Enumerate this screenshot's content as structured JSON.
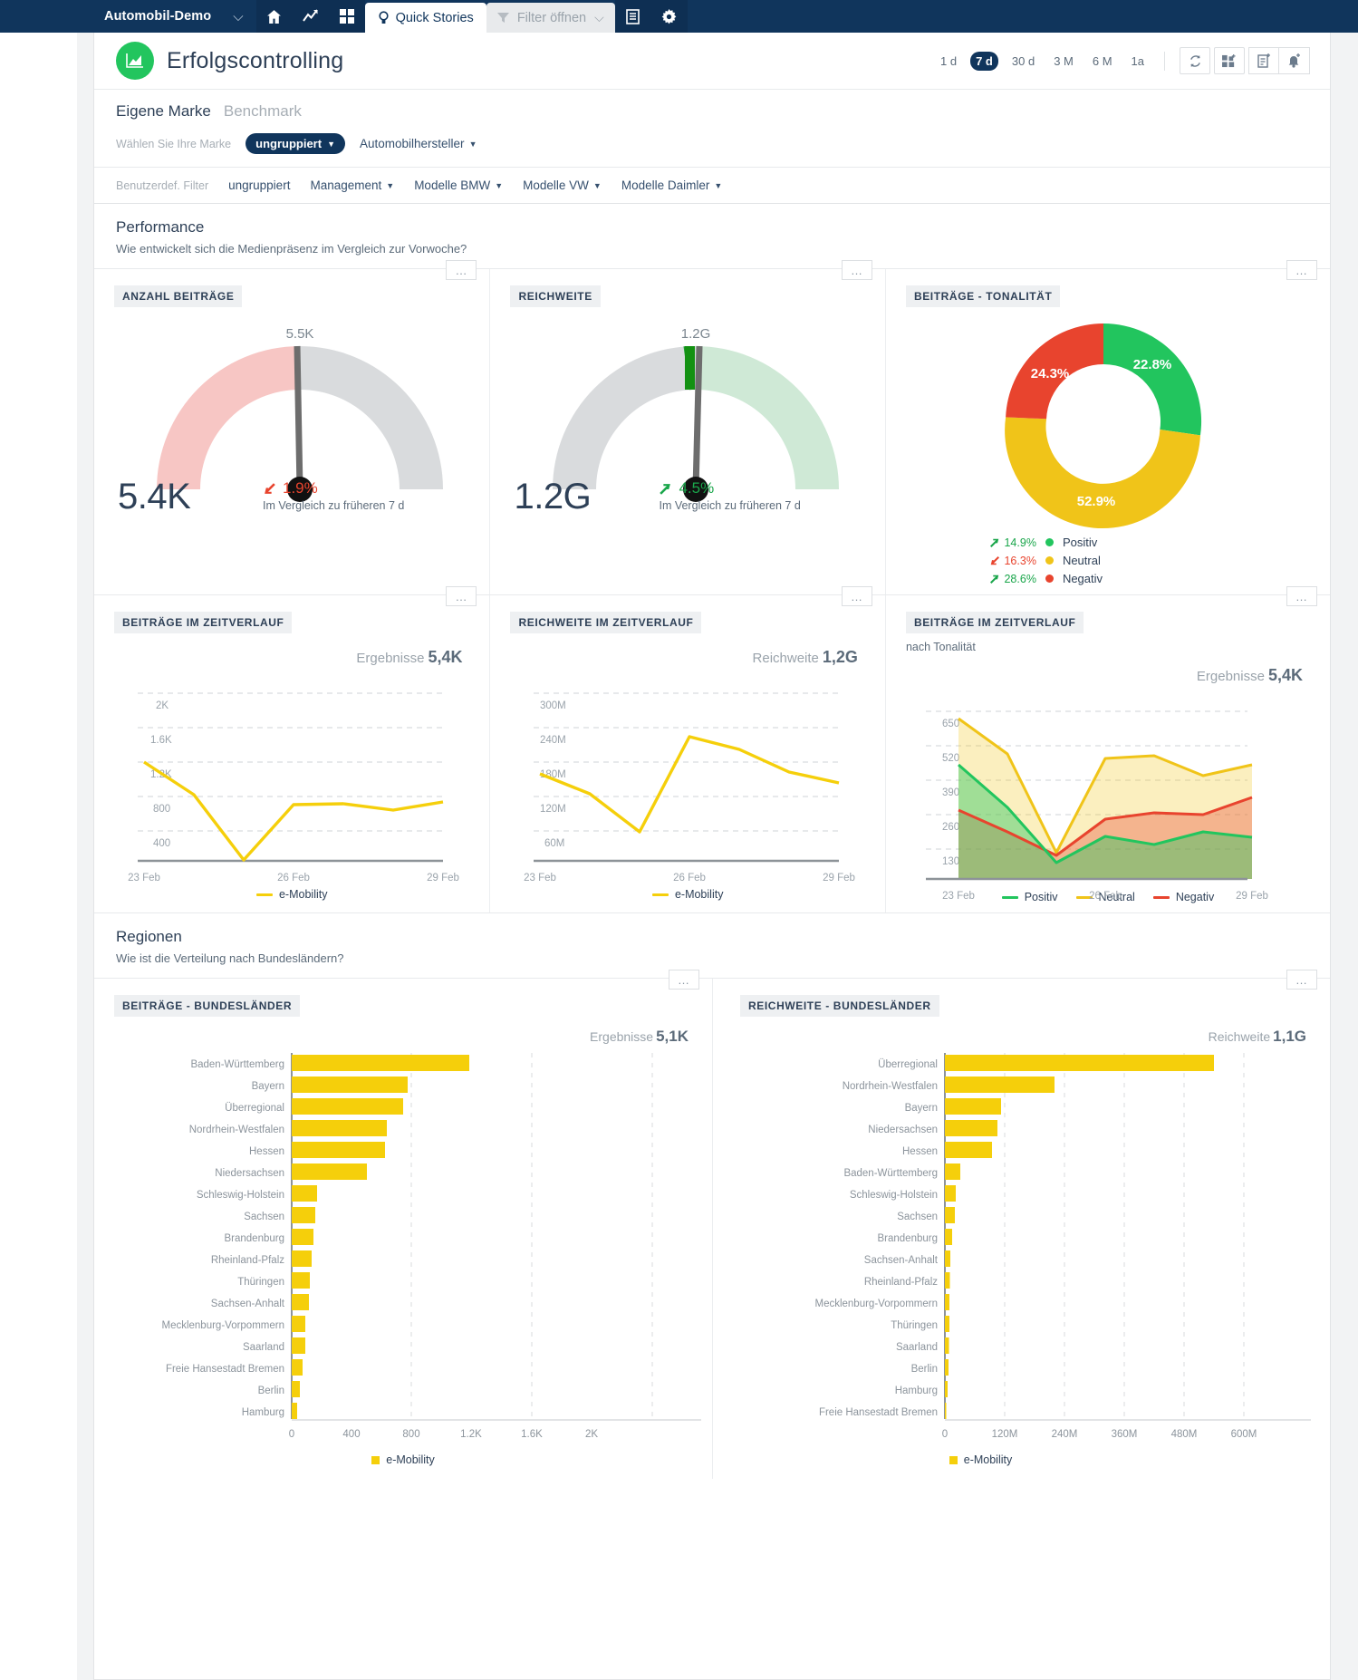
{
  "topnav": {
    "app_title": "Automobil-Demo",
    "quick_stories": "Quick Stories",
    "filter_placeholder": "Filter öffnen",
    "icons": [
      "home-icon",
      "trend-chart-icon",
      "grid-icon",
      "document-icon",
      "settings-gear-icon"
    ]
  },
  "header": {
    "title": "Erfolgscontrolling",
    "ranges": [
      "1 d",
      "7 d",
      "30 d",
      "3 M",
      "6 M",
      "1a"
    ],
    "active_range": "7 d",
    "actions": [
      "refresh-icon",
      "add-widget-icon",
      "new-report-icon",
      "alert-icon"
    ]
  },
  "brandbar": {
    "tab_own": "Eigene Marke",
    "tab_benchmark": "Benchmark",
    "select_label": "Wählen Sie Ihre Marke",
    "group_pill": "ungruppiert",
    "manufacturer_drop": "Automobilhersteller",
    "custom_label": "Benutzerdef. Filter",
    "custom_items": [
      "ungruppiert",
      "Management",
      "Modelle BMW",
      "Modelle VW",
      "Modelle Daimler"
    ]
  },
  "performance": {
    "title": "Performance",
    "subtitle": "Wie entwickelt sich die Medienpräsenz im Vergleich zur Vorwoche?",
    "gauge_posts": {
      "chip": "ANZAHL BEITRÄGE",
      "scale_max": "5.5K",
      "value": "5.4K",
      "delta": "1.9%",
      "delta_dir": "down",
      "delta_note": "Im Vergleich zu früheren 7 d"
    },
    "gauge_reach": {
      "chip": "REICHWEITE",
      "scale_max": "1.2G",
      "value": "1.2G",
      "delta": "4.5%",
      "delta_dir": "up",
      "delta_note": "Im Vergleich zu früheren 7 d"
    },
    "tonality": {
      "chip": "BEITRÄGE - TONALITÄT",
      "legend": [
        {
          "delta": "14.9%",
          "dir": "up",
          "name": "Positiv"
        },
        {
          "delta": "16.3%",
          "dir": "down",
          "name": "Neutral"
        },
        {
          "delta": "28.6%",
          "dir": "up",
          "name": "Negativ"
        }
      ]
    },
    "posts_time": {
      "chip": "BEITRÄGE IM ZEITVERLAUF",
      "results_label": "Ergebnisse",
      "results_value": "5,4K",
      "legend": "e-Mobility"
    },
    "reach_time": {
      "chip": "REICHWEITE IM ZEITVERLAUF",
      "results_label": "Reichweite",
      "results_value": "1,2G",
      "legend": "e-Mobility"
    },
    "tonality_time": {
      "chip": "BEITRÄGE IM ZEITVERLAUF",
      "note": "nach Tonalität",
      "results_label": "Ergebnisse",
      "results_value": "5,4K"
    }
  },
  "regions": {
    "title": "Regionen",
    "subtitle": "Wie ist die Verteilung nach Bundesländern?",
    "posts_chip": "BEITRÄGE - BUNDESLÄNDER",
    "reach_chip": "REICHWEITE - BUNDESLÄNDER",
    "posts_results_label": "Ergebnisse",
    "posts_results_value": "5,1K",
    "reach_results_label": "Reichweite",
    "reach_results_value": "1,1G",
    "legend": "e-Mobility"
  },
  "colors": {
    "yellow": "#f5cf0b",
    "green": "#22c55e",
    "red": "#e8442e",
    "navy": "#10355c",
    "gauge_red_band": "#f7c6c4",
    "gauge_green_band": "#cfe9d6",
    "gauge_grey_band": "#d9dbdd"
  },
  "chart_data": [
    {
      "type": "gauge",
      "title": "ANZAHL BEITRÄGE",
      "value": 5400,
      "value_label": "5.4K",
      "max": 5500,
      "max_label": "5.5K",
      "needle_fraction": 0.5,
      "band_left_color": "#f7c6c4",
      "band_right_color": "#d9dbdd",
      "delta_pct": -1.9
    },
    {
      "type": "gauge",
      "title": "REICHWEITE",
      "value": 1200000000,
      "value_label": "1.2G",
      "max_label": "1.2G",
      "needle_fraction": 0.5,
      "band_left_color": "#d9dbdd",
      "band_right_color": "#cfe9d6",
      "delta_pct": 4.5
    },
    {
      "type": "pie",
      "title": "BEITRÄGE - TONALITÄT",
      "labels": [
        "Positiv",
        "Neutral",
        "Negativ"
      ],
      "values": [
        22.8,
        52.9,
        24.3
      ],
      "value_labels": [
        "22.8%",
        "52.9%",
        "24.3%"
      ],
      "colors": [
        "#22c55e",
        "#f0c419",
        "#e8442e"
      ],
      "donut": true,
      "legend_position": "bottom"
    },
    {
      "type": "line",
      "title": "BEITRÄGE IM ZEITVERLAUF",
      "x": [
        "23 Feb",
        "24 Feb",
        "25 Feb",
        "26 Feb",
        "27 Feb",
        "28 Feb",
        "29 Feb"
      ],
      "xtick_labels": [
        "23 Feb",
        "26 Feb",
        "29 Feb"
      ],
      "series": [
        {
          "name": "e-Mobility",
          "values": [
            1270,
            880,
            250,
            840,
            850,
            805,
            880
          ],
          "color": "#f5cf0b"
        }
      ],
      "yticks": [
        400,
        800,
        1200,
        1600,
        2000
      ],
      "ytick_labels": [
        "400",
        "800",
        "1.2K",
        "1.6K",
        "2K"
      ],
      "ylim": [
        0,
        2200
      ],
      "grid": true,
      "legend_position": "bottom"
    },
    {
      "type": "line",
      "title": "REICHWEITE IM ZEITVERLAUF",
      "x": [
        "23 Feb",
        "24 Feb",
        "25 Feb",
        "26 Feb",
        "27 Feb",
        "28 Feb",
        "29 Feb"
      ],
      "xtick_labels": [
        "23 Feb",
        "26 Feb",
        "29 Feb"
      ],
      "series": [
        {
          "name": "e-Mobility",
          "values": [
            185000000,
            150000000,
            95000000,
            262000000,
            242000000,
            196000000,
            168000000
          ],
          "color": "#f5cf0b"
        }
      ],
      "yticks": [
        60000000,
        120000000,
        180000000,
        240000000,
        300000000
      ],
      "ytick_labels": [
        "60M",
        "120M",
        "180M",
        "240M",
        "300M"
      ],
      "ylim": [
        0,
        330000000
      ],
      "grid": true,
      "legend_position": "bottom"
    },
    {
      "type": "area",
      "title": "BEITRÄGE IM ZEITVERLAUF",
      "subtitle": "nach Tonalität",
      "x": [
        "23 Feb",
        "24 Feb",
        "25 Feb",
        "26 Feb",
        "27 Feb",
        "28 Feb",
        "29 Feb"
      ],
      "xtick_labels": [
        "23 Feb",
        "26 Feb",
        "29 Feb"
      ],
      "series": [
        {
          "name": "Positiv",
          "values": [
            430,
            270,
            60,
            165,
            133,
            180,
            160
          ],
          "color": "#22c55e"
        },
        {
          "name": "Neutral",
          "values": [
            630,
            460,
            100,
            495,
            505,
            398,
            443
          ],
          "color": "#f0c419"
        },
        {
          "name": "Negativ",
          "values": [
            258,
            175,
            90,
            215,
            240,
            232,
            297
          ],
          "color": "#e8442e"
        }
      ],
      "yticks": [
        130,
        260,
        390,
        520,
        650
      ],
      "ytick_labels": [
        "130",
        "260",
        "390",
        "520",
        "650"
      ],
      "ylim": [
        0,
        715
      ],
      "grid": true,
      "legend_position": "bottom"
    },
    {
      "type": "bar",
      "orientation": "horizontal",
      "title": "BEITRÄGE - BUNDESLÄNDER",
      "results_label": "Ergebnisse",
      "results_value": "5,1K",
      "categories": [
        "Baden-Württemberg",
        "Bayern",
        "Überregional",
        "Nordrhein-Westfalen",
        "Hessen",
        "Niedersachsen",
        "Schleswig-Holstein",
        "Sachsen",
        "Brandenburg",
        "Rheinland-Pfalz",
        "Thüringen",
        "Sachsen-Anhalt",
        "Mecklenburg-Vorpommern",
        "Saarland",
        "Freie Hansestadt Bremen",
        "Berlin",
        "Hamburg"
      ],
      "values": [
        1180,
        770,
        740,
        635,
        620,
        500,
        170,
        158,
        145,
        130,
        118,
        112,
        92,
        88,
        72,
        52,
        34
      ],
      "xticks": [
        0,
        400,
        800,
        1200,
        1600,
        2000
      ],
      "xtick_labels": [
        "0",
        "400",
        "800",
        "1.2K",
        "1.6K",
        "2K"
      ],
      "xlim": [
        0,
        2000
      ],
      "color": "#f5cf0b",
      "series_name": "e-Mobility"
    },
    {
      "type": "bar",
      "orientation": "horizontal",
      "title": "REICHWEITE - BUNDESLÄNDER",
      "results_label": "Reichweite",
      "results_value": "1,1G",
      "categories": [
        "Überregional",
        "Nordrhein-Westfalen",
        "Bayern",
        "Niedersachsen",
        "Hessen",
        "Baden-Württemberg",
        "Schleswig-Holstein",
        "Sachsen",
        "Brandenburg",
        "Sachsen-Anhalt",
        "Rheinland-Pfalz",
        "Mecklenburg-Vorpommern",
        "Thüringen",
        "Saarland",
        "Berlin",
        "Hamburg",
        "Freie Hansestadt Bremen"
      ],
      "values": [
        540000000,
        220000000,
        112000000,
        106000000,
        94000000,
        30000000,
        21000000,
        20000000,
        14000000,
        9000000,
        8000000,
        7500000,
        7000000,
        6500000,
        5500000,
        4000000,
        1500000
      ],
      "xticks": [
        0,
        120000000,
        240000000,
        360000000,
        480000000,
        600000000
      ],
      "xtick_labels": [
        "0",
        "120M",
        "240M",
        "360M",
        "480M",
        "600M"
      ],
      "xlim": [
        0,
        620000000
      ],
      "color": "#f5cf0b",
      "series_name": "e-Mobility"
    }
  ]
}
